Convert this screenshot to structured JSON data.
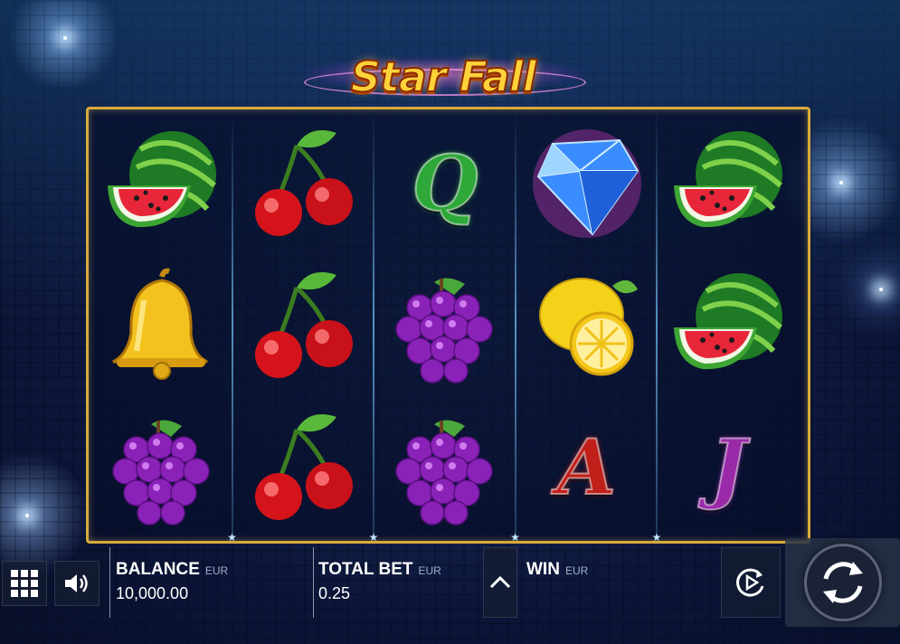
{
  "game": {
    "title": "Star Fall"
  },
  "reels": [
    [
      "watermelon",
      "bell",
      "grapes"
    ],
    [
      "cherries",
      "cherries",
      "cherries"
    ],
    [
      "Q",
      "grapes",
      "grapes"
    ],
    [
      "diamond",
      "lemon",
      "A"
    ],
    [
      "watermelon",
      "watermelon",
      "J"
    ]
  ],
  "letter_colors": {
    "Q": "#2fa83a",
    "A": "#c0201a",
    "J": "#9a2aa8"
  },
  "hud": {
    "menu_icon": "grid-icon",
    "sound_icon": "speaker-icon",
    "balance_label": "BALANCE",
    "balance_currency": "EUR",
    "balance_value": "10,000.00",
    "total_bet_label": "TOTAL BET",
    "total_bet_currency": "EUR",
    "total_bet_value": "0.25",
    "win_label": "WIN",
    "win_currency": "EUR",
    "bet_toggle_icon": "chevron-up-icon",
    "autoplay_icon": "autoplay-icon",
    "spin_icon": "spin-icon"
  },
  "colors": {
    "frame": "#d8aa3a",
    "logo": "#ffd23a"
  }
}
